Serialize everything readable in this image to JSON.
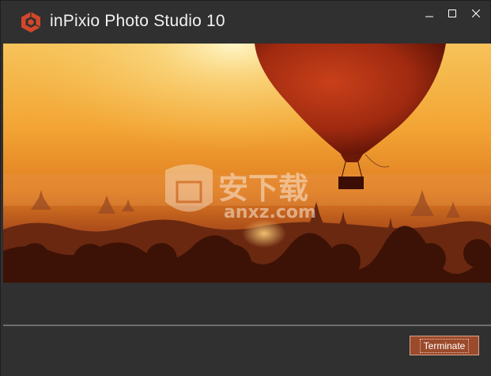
{
  "window": {
    "title": "inPixio Photo Studio 10",
    "logo_icon": "inpixio-cube-logo-icon",
    "controls": {
      "minimize_icon": "minimize-icon",
      "maximize_icon": "maximize-icon",
      "close_icon": "close-icon"
    }
  },
  "banner": {
    "image": "hot-air-balloon-over-misty-temples-at-sunset",
    "watermark_logo_icon": "shield-watermark-icon",
    "watermark_text": "安下载",
    "watermark_domain": "anxz.com"
  },
  "footer": {
    "terminate_label": "Terminate"
  },
  "colors": {
    "window_bg": "#303031",
    "button_bg": "#9c4a2c",
    "title_text": "#f2f2f2",
    "divider": "#6e6e6e"
  }
}
